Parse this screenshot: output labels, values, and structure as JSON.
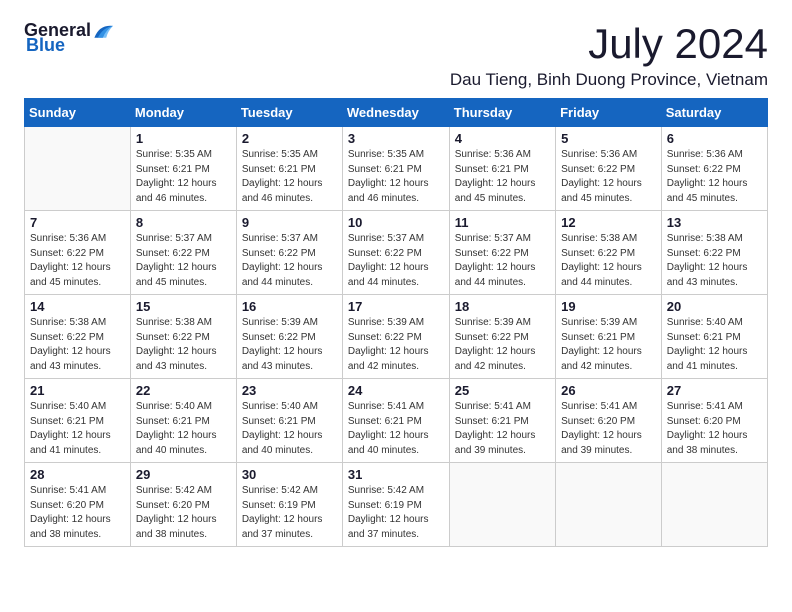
{
  "logo": {
    "text_general": "General",
    "text_blue": "Blue"
  },
  "title": {
    "month_year": "July 2024",
    "location": "Dau Tieng, Binh Duong Province, Vietnam"
  },
  "days_of_week": [
    "Sunday",
    "Monday",
    "Tuesday",
    "Wednesday",
    "Thursday",
    "Friday",
    "Saturday"
  ],
  "weeks": [
    [
      {
        "day": "",
        "info": ""
      },
      {
        "day": "1",
        "info": "Sunrise: 5:35 AM\nSunset: 6:21 PM\nDaylight: 12 hours and 46 minutes."
      },
      {
        "day": "2",
        "info": "Sunrise: 5:35 AM\nSunset: 6:21 PM\nDaylight: 12 hours and 46 minutes."
      },
      {
        "day": "3",
        "info": "Sunrise: 5:35 AM\nSunset: 6:21 PM\nDaylight: 12 hours and 46 minutes."
      },
      {
        "day": "4",
        "info": "Sunrise: 5:36 AM\nSunset: 6:21 PM\nDaylight: 12 hours and 45 minutes."
      },
      {
        "day": "5",
        "info": "Sunrise: 5:36 AM\nSunset: 6:22 PM\nDaylight: 12 hours and 45 minutes."
      },
      {
        "day": "6",
        "info": "Sunrise: 5:36 AM\nSunset: 6:22 PM\nDaylight: 12 hours and 45 minutes."
      }
    ],
    [
      {
        "day": "7",
        "info": "Sunrise: 5:36 AM\nSunset: 6:22 PM\nDaylight: 12 hours and 45 minutes."
      },
      {
        "day": "8",
        "info": "Sunrise: 5:37 AM\nSunset: 6:22 PM\nDaylight: 12 hours and 45 minutes."
      },
      {
        "day": "9",
        "info": "Sunrise: 5:37 AM\nSunset: 6:22 PM\nDaylight: 12 hours and 44 minutes."
      },
      {
        "day": "10",
        "info": "Sunrise: 5:37 AM\nSunset: 6:22 PM\nDaylight: 12 hours and 44 minutes."
      },
      {
        "day": "11",
        "info": "Sunrise: 5:37 AM\nSunset: 6:22 PM\nDaylight: 12 hours and 44 minutes."
      },
      {
        "day": "12",
        "info": "Sunrise: 5:38 AM\nSunset: 6:22 PM\nDaylight: 12 hours and 44 minutes."
      },
      {
        "day": "13",
        "info": "Sunrise: 5:38 AM\nSunset: 6:22 PM\nDaylight: 12 hours and 43 minutes."
      }
    ],
    [
      {
        "day": "14",
        "info": "Sunrise: 5:38 AM\nSunset: 6:22 PM\nDaylight: 12 hours and 43 minutes."
      },
      {
        "day": "15",
        "info": "Sunrise: 5:38 AM\nSunset: 6:22 PM\nDaylight: 12 hours and 43 minutes."
      },
      {
        "day": "16",
        "info": "Sunrise: 5:39 AM\nSunset: 6:22 PM\nDaylight: 12 hours and 43 minutes."
      },
      {
        "day": "17",
        "info": "Sunrise: 5:39 AM\nSunset: 6:22 PM\nDaylight: 12 hours and 42 minutes."
      },
      {
        "day": "18",
        "info": "Sunrise: 5:39 AM\nSunset: 6:22 PM\nDaylight: 12 hours and 42 minutes."
      },
      {
        "day": "19",
        "info": "Sunrise: 5:39 AM\nSunset: 6:21 PM\nDaylight: 12 hours and 42 minutes."
      },
      {
        "day": "20",
        "info": "Sunrise: 5:40 AM\nSunset: 6:21 PM\nDaylight: 12 hours and 41 minutes."
      }
    ],
    [
      {
        "day": "21",
        "info": "Sunrise: 5:40 AM\nSunset: 6:21 PM\nDaylight: 12 hours and 41 minutes."
      },
      {
        "day": "22",
        "info": "Sunrise: 5:40 AM\nSunset: 6:21 PM\nDaylight: 12 hours and 40 minutes."
      },
      {
        "day": "23",
        "info": "Sunrise: 5:40 AM\nSunset: 6:21 PM\nDaylight: 12 hours and 40 minutes."
      },
      {
        "day": "24",
        "info": "Sunrise: 5:41 AM\nSunset: 6:21 PM\nDaylight: 12 hours and 40 minutes."
      },
      {
        "day": "25",
        "info": "Sunrise: 5:41 AM\nSunset: 6:21 PM\nDaylight: 12 hours and 39 minutes."
      },
      {
        "day": "26",
        "info": "Sunrise: 5:41 AM\nSunset: 6:20 PM\nDaylight: 12 hours and 39 minutes."
      },
      {
        "day": "27",
        "info": "Sunrise: 5:41 AM\nSunset: 6:20 PM\nDaylight: 12 hours and 38 minutes."
      }
    ],
    [
      {
        "day": "28",
        "info": "Sunrise: 5:41 AM\nSunset: 6:20 PM\nDaylight: 12 hours and 38 minutes."
      },
      {
        "day": "29",
        "info": "Sunrise: 5:42 AM\nSunset: 6:20 PM\nDaylight: 12 hours and 38 minutes."
      },
      {
        "day": "30",
        "info": "Sunrise: 5:42 AM\nSunset: 6:19 PM\nDaylight: 12 hours and 37 minutes."
      },
      {
        "day": "31",
        "info": "Sunrise: 5:42 AM\nSunset: 6:19 PM\nDaylight: 12 hours and 37 minutes."
      },
      {
        "day": "",
        "info": ""
      },
      {
        "day": "",
        "info": ""
      },
      {
        "day": "",
        "info": ""
      }
    ]
  ]
}
